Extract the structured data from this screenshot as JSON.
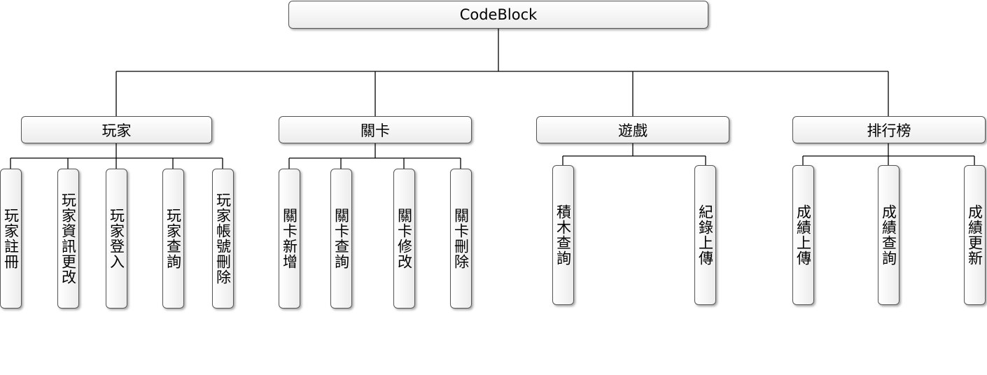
{
  "root": {
    "label": "CodeBlock"
  },
  "categories": [
    {
      "label": "玩家",
      "children": [
        "玩家註冊",
        "玩家資訊更改",
        "玩家登入",
        "玩家查詢",
        "玩家帳號刪除"
      ]
    },
    {
      "label": "關卡",
      "children": [
        "關卡新增",
        "關卡查詢",
        "關卡修改",
        "關卡刪除"
      ]
    },
    {
      "label": "遊戲",
      "children": [
        "積木查詢",
        "紀錄上傳"
      ]
    },
    {
      "label": "排行榜",
      "children": [
        "成績上傳",
        "成績查詢",
        "成績更新"
      ]
    }
  ]
}
